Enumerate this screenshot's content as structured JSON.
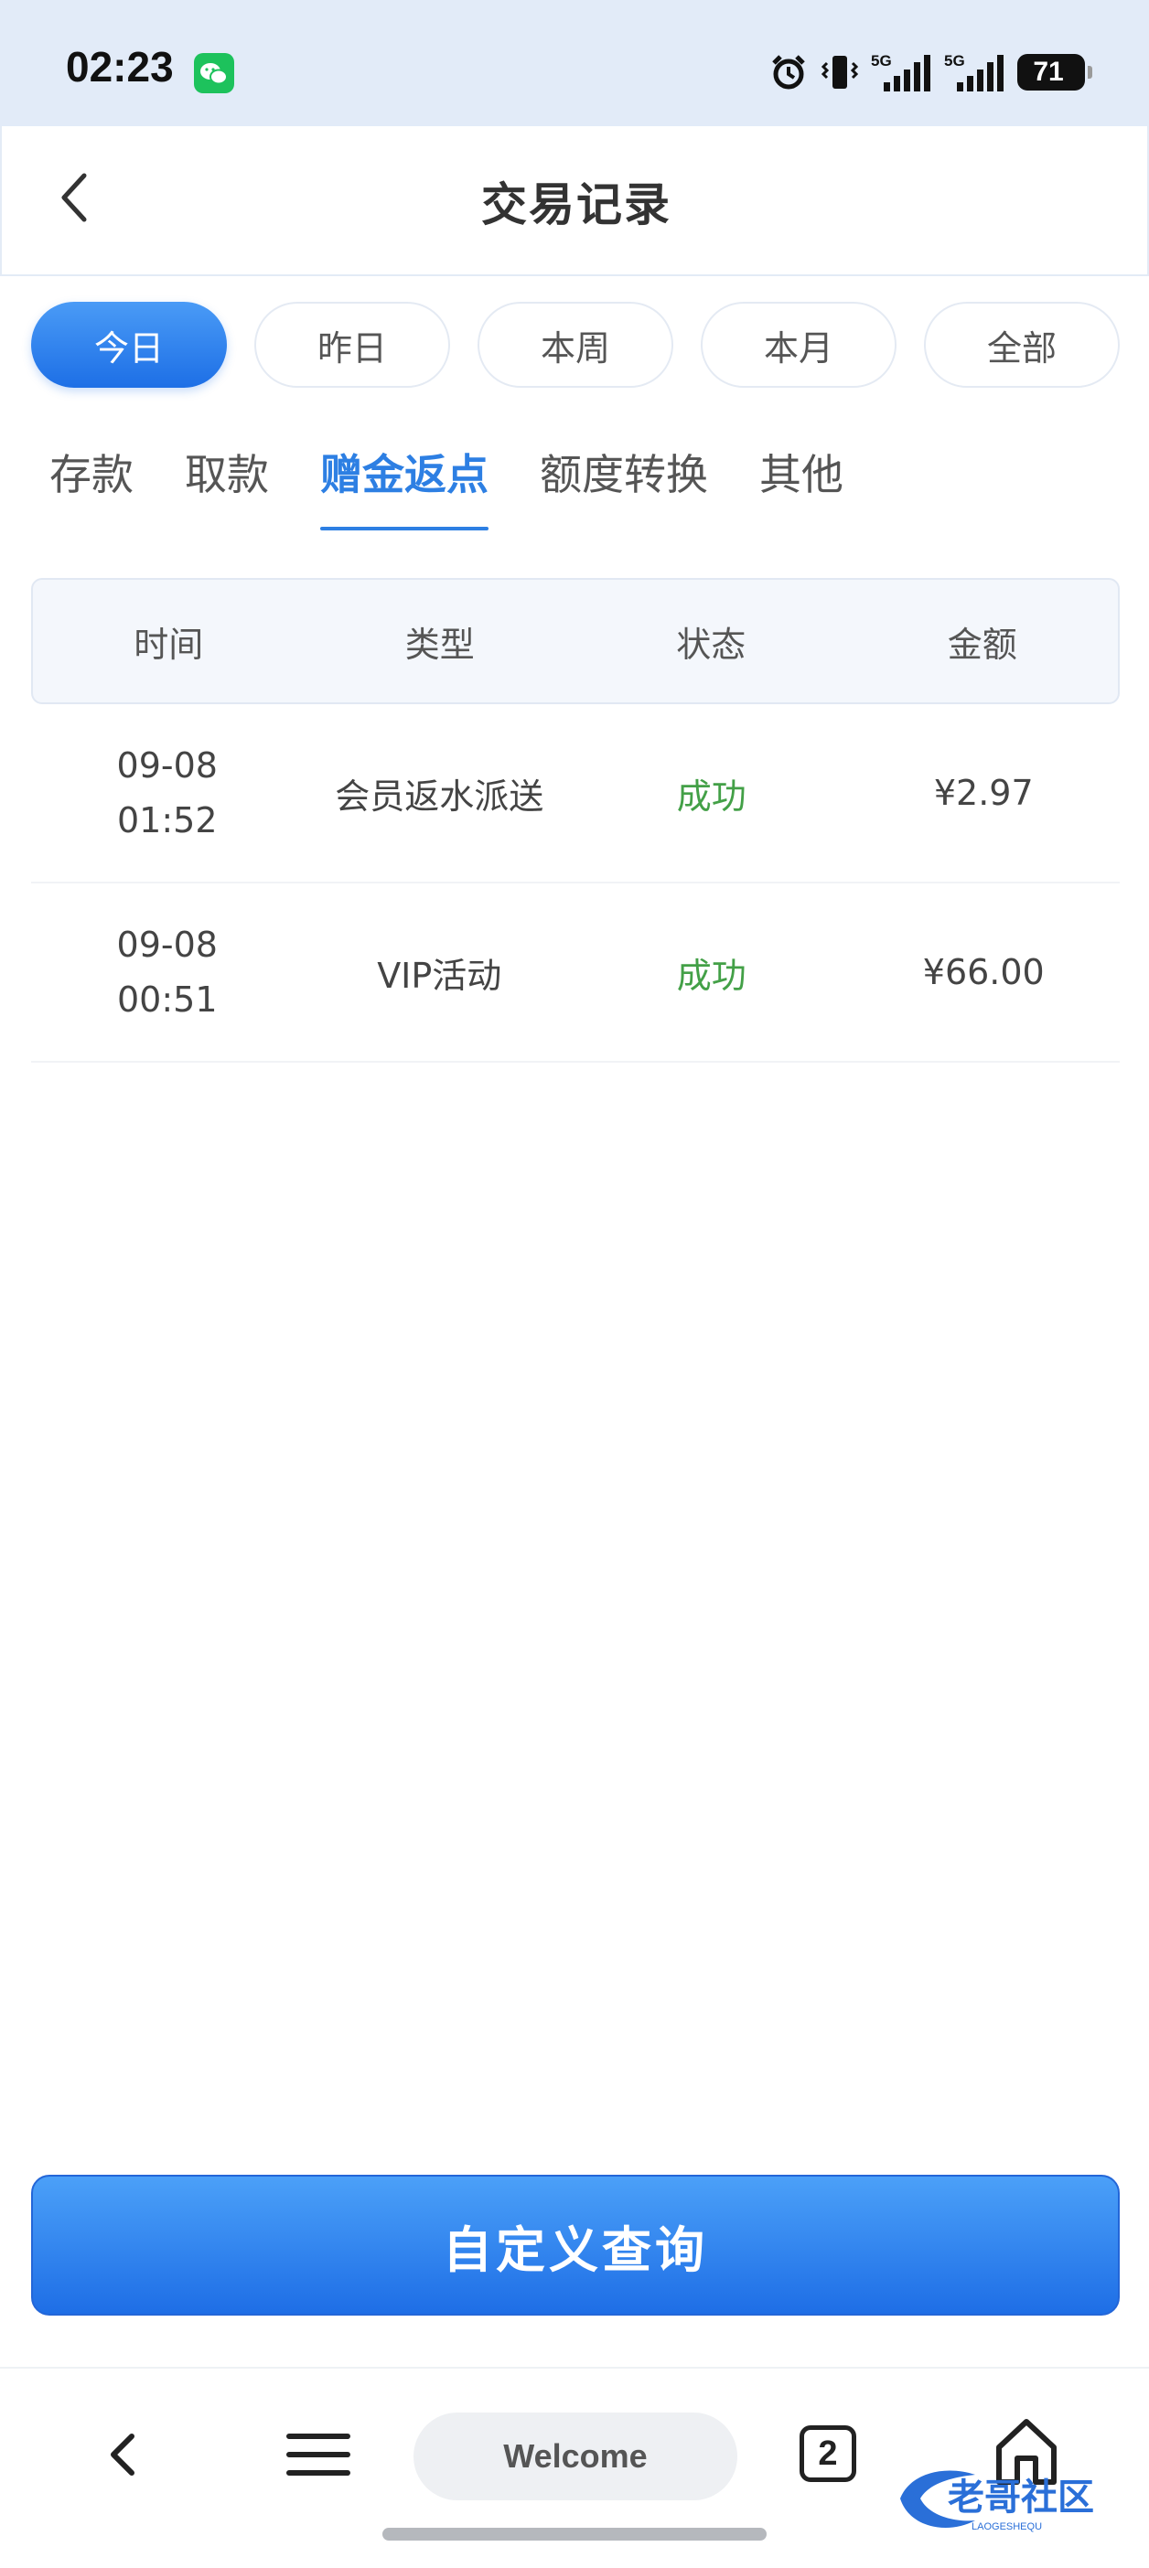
{
  "status_bar": {
    "time": "02:23",
    "battery": "71",
    "icons": [
      "wechat-icon",
      "alarm-icon",
      "vibrate-icon",
      "signal-5g-icon",
      "signal-5g-icon",
      "battery-icon"
    ]
  },
  "header": {
    "title": "交易记录",
    "back_icon": "chevron-left-icon"
  },
  "date_filters": [
    {
      "label": "今日",
      "active": true
    },
    {
      "label": "昨日",
      "active": false
    },
    {
      "label": "本周",
      "active": false
    },
    {
      "label": "本月",
      "active": false
    },
    {
      "label": "全部",
      "active": false
    }
  ],
  "category_tabs": [
    {
      "label": "存款",
      "active": false
    },
    {
      "label": "取款",
      "active": false
    },
    {
      "label": "赠金返点",
      "active": true
    },
    {
      "label": "额度转换",
      "active": false
    },
    {
      "label": "其他",
      "active": false
    }
  ],
  "table": {
    "columns": [
      "时间",
      "类型",
      "状态",
      "金额"
    ],
    "rows": [
      {
        "date": "09-08",
        "time": "01:52",
        "type": "会员返水派送",
        "status": "成功",
        "amount": "¥2.97"
      },
      {
        "date": "09-08",
        "time": "00:51",
        "type": "VIP活动",
        "status": "成功",
        "amount": "¥66.00"
      }
    ]
  },
  "query_button": {
    "label": "自定义查询"
  },
  "browser_bar": {
    "address": "Welcome",
    "tab_count": "2",
    "watermark_text": "老哥社区",
    "watermark_sub": "LAOGESHEQU"
  },
  "colors": {
    "accent": "#2d7fe3",
    "success": "#43a047",
    "status_bar_bg": "#e2ebf8"
  }
}
